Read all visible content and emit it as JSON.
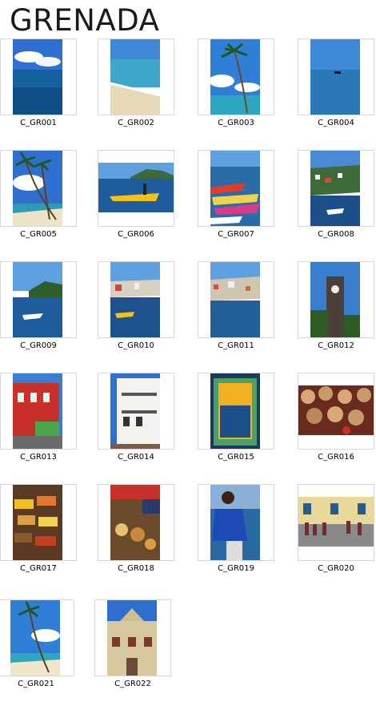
{
  "page": {
    "title": "GRENADA"
  },
  "thumbnails": [
    {
      "label": "C_GR001"
    },
    {
      "label": "C_GR002"
    },
    {
      "label": "C_GR003"
    },
    {
      "label": "C_GR004"
    },
    {
      "label": "C_GR005"
    },
    {
      "label": "C_GR006"
    },
    {
      "label": "C_GR007"
    },
    {
      "label": "C_GR008"
    },
    {
      "label": "C_GR009"
    },
    {
      "label": "C_GR010"
    },
    {
      "label": "C_GR011"
    },
    {
      "label": "C_GR012"
    },
    {
      "label": "C_GR013"
    },
    {
      "label": "C_GR014"
    },
    {
      "label": "C_GR015"
    },
    {
      "label": "C_GR016"
    },
    {
      "label": "C_GR017"
    },
    {
      "label": "C_GR018"
    },
    {
      "label": "C_GR019"
    },
    {
      "label": "C_GR020"
    },
    {
      "label": "C_GR021"
    },
    {
      "label": "C_GR022"
    }
  ],
  "colors": {
    "frame_border": "#d8d8d8",
    "sea": "#1e5aa0",
    "sky": "#3f86d6",
    "sand": "#e8dcc0"
  }
}
